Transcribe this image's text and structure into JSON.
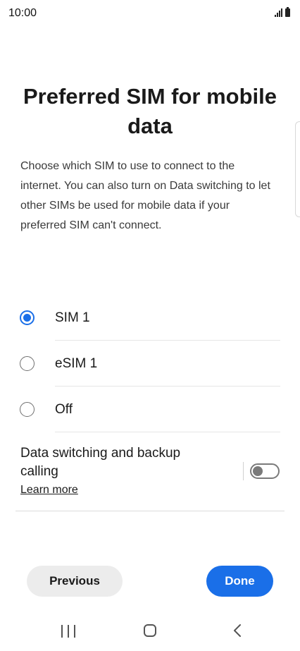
{
  "status_bar": {
    "time": "10:00"
  },
  "title": "Preferred SIM for mobile data",
  "description": "Choose which SIM to use to connect to the internet. You can also turn on Data switching to let other SIMs be used for mobile data if your preferred SIM can't connect.",
  "sim_options": [
    {
      "label": "SIM 1",
      "selected": true
    },
    {
      "label": "eSIM 1",
      "selected": false
    },
    {
      "label": "Off",
      "selected": false
    }
  ],
  "data_switching": {
    "title": "Data switching and backup calling",
    "learn_more": "Learn more",
    "enabled": false
  },
  "buttons": {
    "previous": "Previous",
    "done": "Done"
  },
  "colors": {
    "accent": "#1a6fe8",
    "secondary_button": "#ececec"
  }
}
